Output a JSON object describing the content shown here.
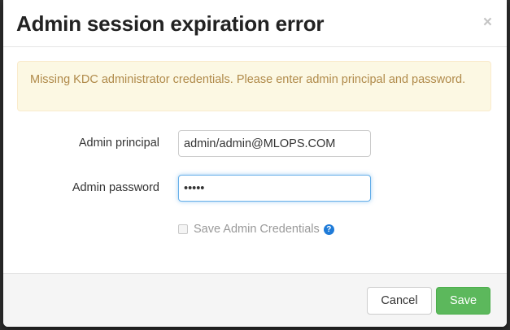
{
  "modal": {
    "title": "Admin session expiration error",
    "close_glyph": "×"
  },
  "alert": {
    "message": "Missing KDC administrator credentials. Please enter admin principal and password."
  },
  "form": {
    "principal_label": "Admin principal",
    "principal_value": "admin/admin@MLOPS.COM",
    "password_label": "Admin password",
    "password_value": "•••••",
    "save_credentials_label": "Save Admin Credentials",
    "save_credentials_checked": false,
    "help_glyph": "?"
  },
  "footer": {
    "cancel_label": "Cancel",
    "save_label": "Save"
  },
  "colors": {
    "alert_bg": "#fcf8e3",
    "alert_text": "#b08a4a",
    "save_button": "#5cb85c",
    "focus_border": "#66afe9",
    "help_icon": "#1f7bd8"
  },
  "icons": {
    "close": "close-icon",
    "help": "question-circle-icon",
    "checkbox": "checkbox-unchecked"
  }
}
